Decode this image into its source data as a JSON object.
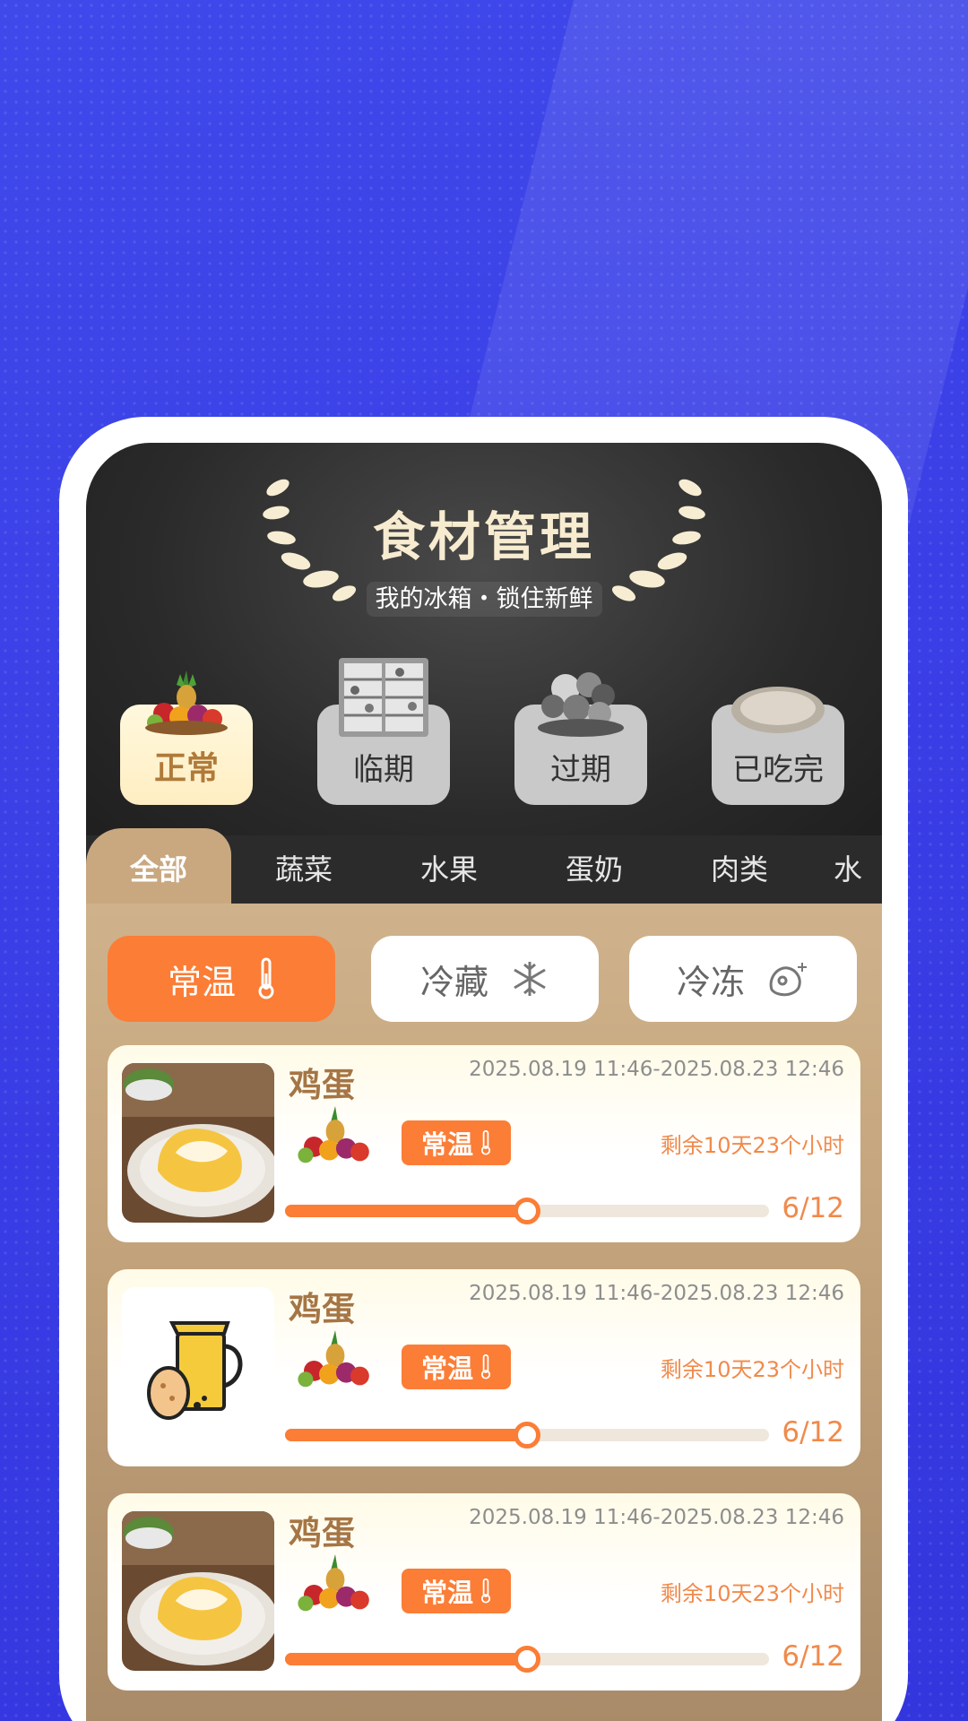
{
  "header": {
    "title": "食材管理",
    "subtitle": "我的冰箱・锁住新鲜"
  },
  "status_buttons": [
    {
      "label": "正常",
      "icon": "fruit-basket-icon",
      "active": true
    },
    {
      "label": "临期",
      "icon": "fridge-icon",
      "active": false
    },
    {
      "label": "过期",
      "icon": "vegetables-icon",
      "active": false
    },
    {
      "label": "已吃完",
      "icon": "empty-plate-icon",
      "active": false
    }
  ],
  "category_tabs": [
    {
      "label": "全部",
      "active": true
    },
    {
      "label": "蔬菜"
    },
    {
      "label": "水果"
    },
    {
      "label": "蛋奶"
    },
    {
      "label": "肉类"
    },
    {
      "label": "水"
    }
  ],
  "temperature_filters": [
    {
      "label": "常温",
      "icon": "thermometer-icon",
      "active": true
    },
    {
      "label": "冷藏",
      "icon": "snowflake-icon"
    },
    {
      "label": "冷冻",
      "icon": "frozen-meat-icon"
    }
  ],
  "items": [
    {
      "name": "鸡蛋",
      "date_range": "2025.08.19 11:46-2025.08.23 12:46",
      "storage_tag": "常温",
      "remaining": "剩余10天23个小时",
      "count_label": "6/12",
      "progress": 0.5,
      "thumb": "omelette-photo"
    },
    {
      "name": "鸡蛋",
      "date_range": "2025.08.19 11:46-2025.08.23 12:46",
      "storage_tag": "常温",
      "remaining": "剩余10天23个小时",
      "count_label": "6/12",
      "progress": 0.5,
      "thumb": "egg-and-milk-icon"
    },
    {
      "name": "鸡蛋",
      "date_range": "2025.08.19 11:46-2025.08.23 12:46",
      "storage_tag": "常温",
      "remaining": "剩余10天23个小时",
      "count_label": "6/12",
      "progress": 0.5,
      "thumb": "omelette-photo"
    }
  ],
  "colors": {
    "accent": "#fb7d36",
    "background": "#3b3de6",
    "header_dark": "#2a2a2a",
    "brown_text": "#a57545"
  }
}
